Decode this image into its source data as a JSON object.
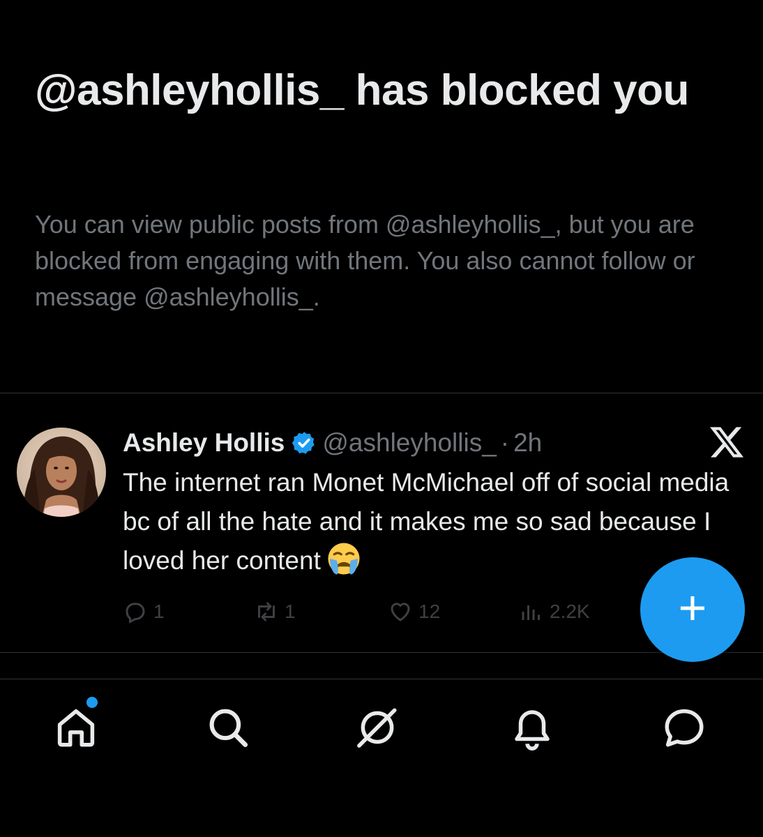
{
  "blocked_notice": {
    "title": "@ashleyhollis_ has blocked you",
    "description": "You can view public posts from @ashleyhollis_, but you are blocked from engaging with them. You also cannot follow or message @ashleyhollis_."
  },
  "post": {
    "author_name": "Ashley Hollis",
    "verified": true,
    "handle": "@ashleyhollis_",
    "separator": "·",
    "time": "2h",
    "text": "The internet ran Monet McMichael off of social media bc of all the hate and it makes me so sad because I loved her content",
    "emoji": "crying-face-emoji",
    "source_icon": "x-logo-icon",
    "actions": {
      "replies": "1",
      "reposts": "1",
      "likes": "12",
      "views": "2.2K"
    }
  },
  "compose_button": {
    "glyph": "+",
    "icon": "plus-icon"
  },
  "bottom_nav": {
    "items": [
      {
        "icon": "home-icon",
        "has_notification_dot": true
      },
      {
        "icon": "search-icon"
      },
      {
        "icon": "grok-icon"
      },
      {
        "icon": "bell-icon"
      },
      {
        "icon": "messages-icon"
      }
    ]
  },
  "colors": {
    "background": "#000000",
    "primary_text": "#e7e9ea",
    "secondary_text": "#71767b",
    "accent": "#1d9bf0",
    "divider": "#2f3336"
  }
}
